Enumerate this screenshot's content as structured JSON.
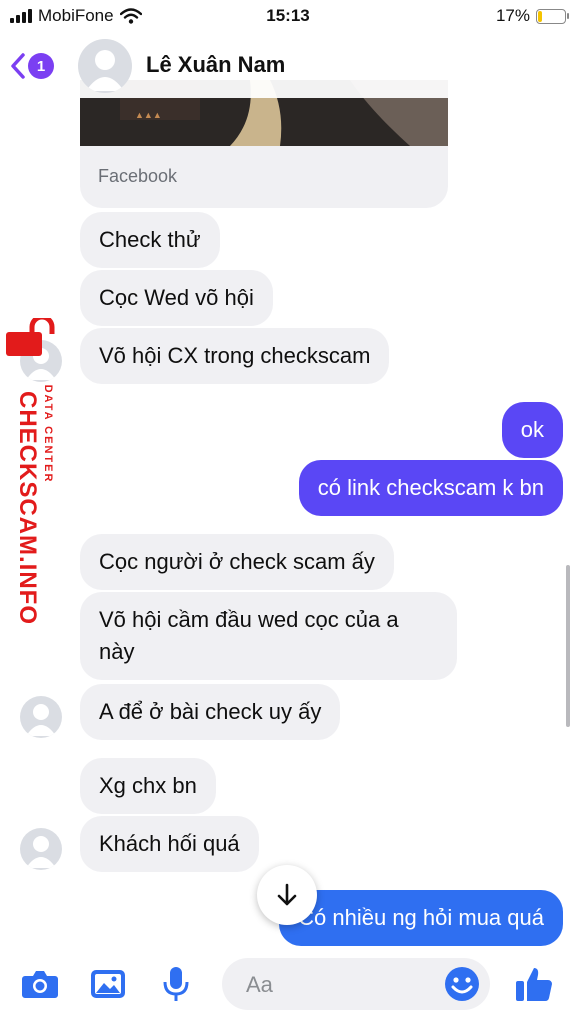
{
  "status": {
    "carrier": "MobiFone",
    "time": "15:13",
    "battery_pct": 17,
    "battery_label": "17%"
  },
  "header": {
    "back_badge": "1",
    "contact_name": "Lê Xuân Nam"
  },
  "messages": {
    "card_source": "Facebook",
    "m1": "Check thử",
    "m2": "Cọc Wed võ hội",
    "m3": "Võ hội CX trong checkscam",
    "m4": "ok",
    "m5": "có link checkscam k bn",
    "m6": "Cọc người ở check scam ấy",
    "m7": "Võ hội cầm đầu wed cọc của a này",
    "m8": "A để ở bài check uy ấy",
    "m9": "Xg chx bn",
    "m10": "Khách hối quá",
    "m11": "Có nhiều ng hỏi mua quá"
  },
  "watermark": {
    "brand": "CHECKSCAM.INFO",
    "sub": "DATA CENTER"
  },
  "composer": {
    "placeholder": "Aa"
  },
  "colors": {
    "accent": "#5a47f5",
    "accent_blue": "#2f6ff1",
    "bubble_in": "#f0f0f3",
    "badge": "#7b3ff2",
    "watermark": "#e21b1b"
  },
  "icons": [
    "back-chevron-icon",
    "camera-icon",
    "photo-icon",
    "microphone-icon",
    "emoji-icon",
    "thumbs-up-icon",
    "arrow-down-icon"
  ]
}
